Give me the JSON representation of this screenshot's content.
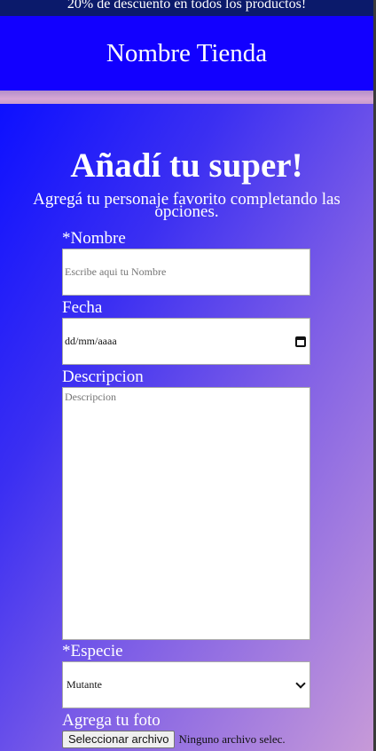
{
  "promo": {
    "text": "20% de descuento en todos los productos!"
  },
  "header": {
    "store_name": "Nombre Tienda"
  },
  "form": {
    "title": "Añadí tu super!",
    "subtitle": "Agregá tu personaje favorito completando las opciones.",
    "name": {
      "label": "*Nombre",
      "placeholder": "Escribe aqui tu Nombre",
      "value": ""
    },
    "date": {
      "label": "Fecha",
      "placeholder": "dd/mm/aaaa"
    },
    "description": {
      "label": "Descripcion",
      "placeholder": "Descripcion"
    },
    "species": {
      "label": "*Especie",
      "selected": "Mutante"
    },
    "photo": {
      "label": "Agrega tu foto",
      "button_label": "Seleccionar archivo",
      "status": "Ninguno archivo selec."
    }
  },
  "colors": {
    "promo_bg": "#0b1a6b",
    "header_bg": "#1200ff",
    "gradient_start": "#0d10ff",
    "gradient_end": "#c79ad8"
  },
  "icons": {
    "date": "calendar-icon",
    "select": "chevron-down-icon"
  }
}
